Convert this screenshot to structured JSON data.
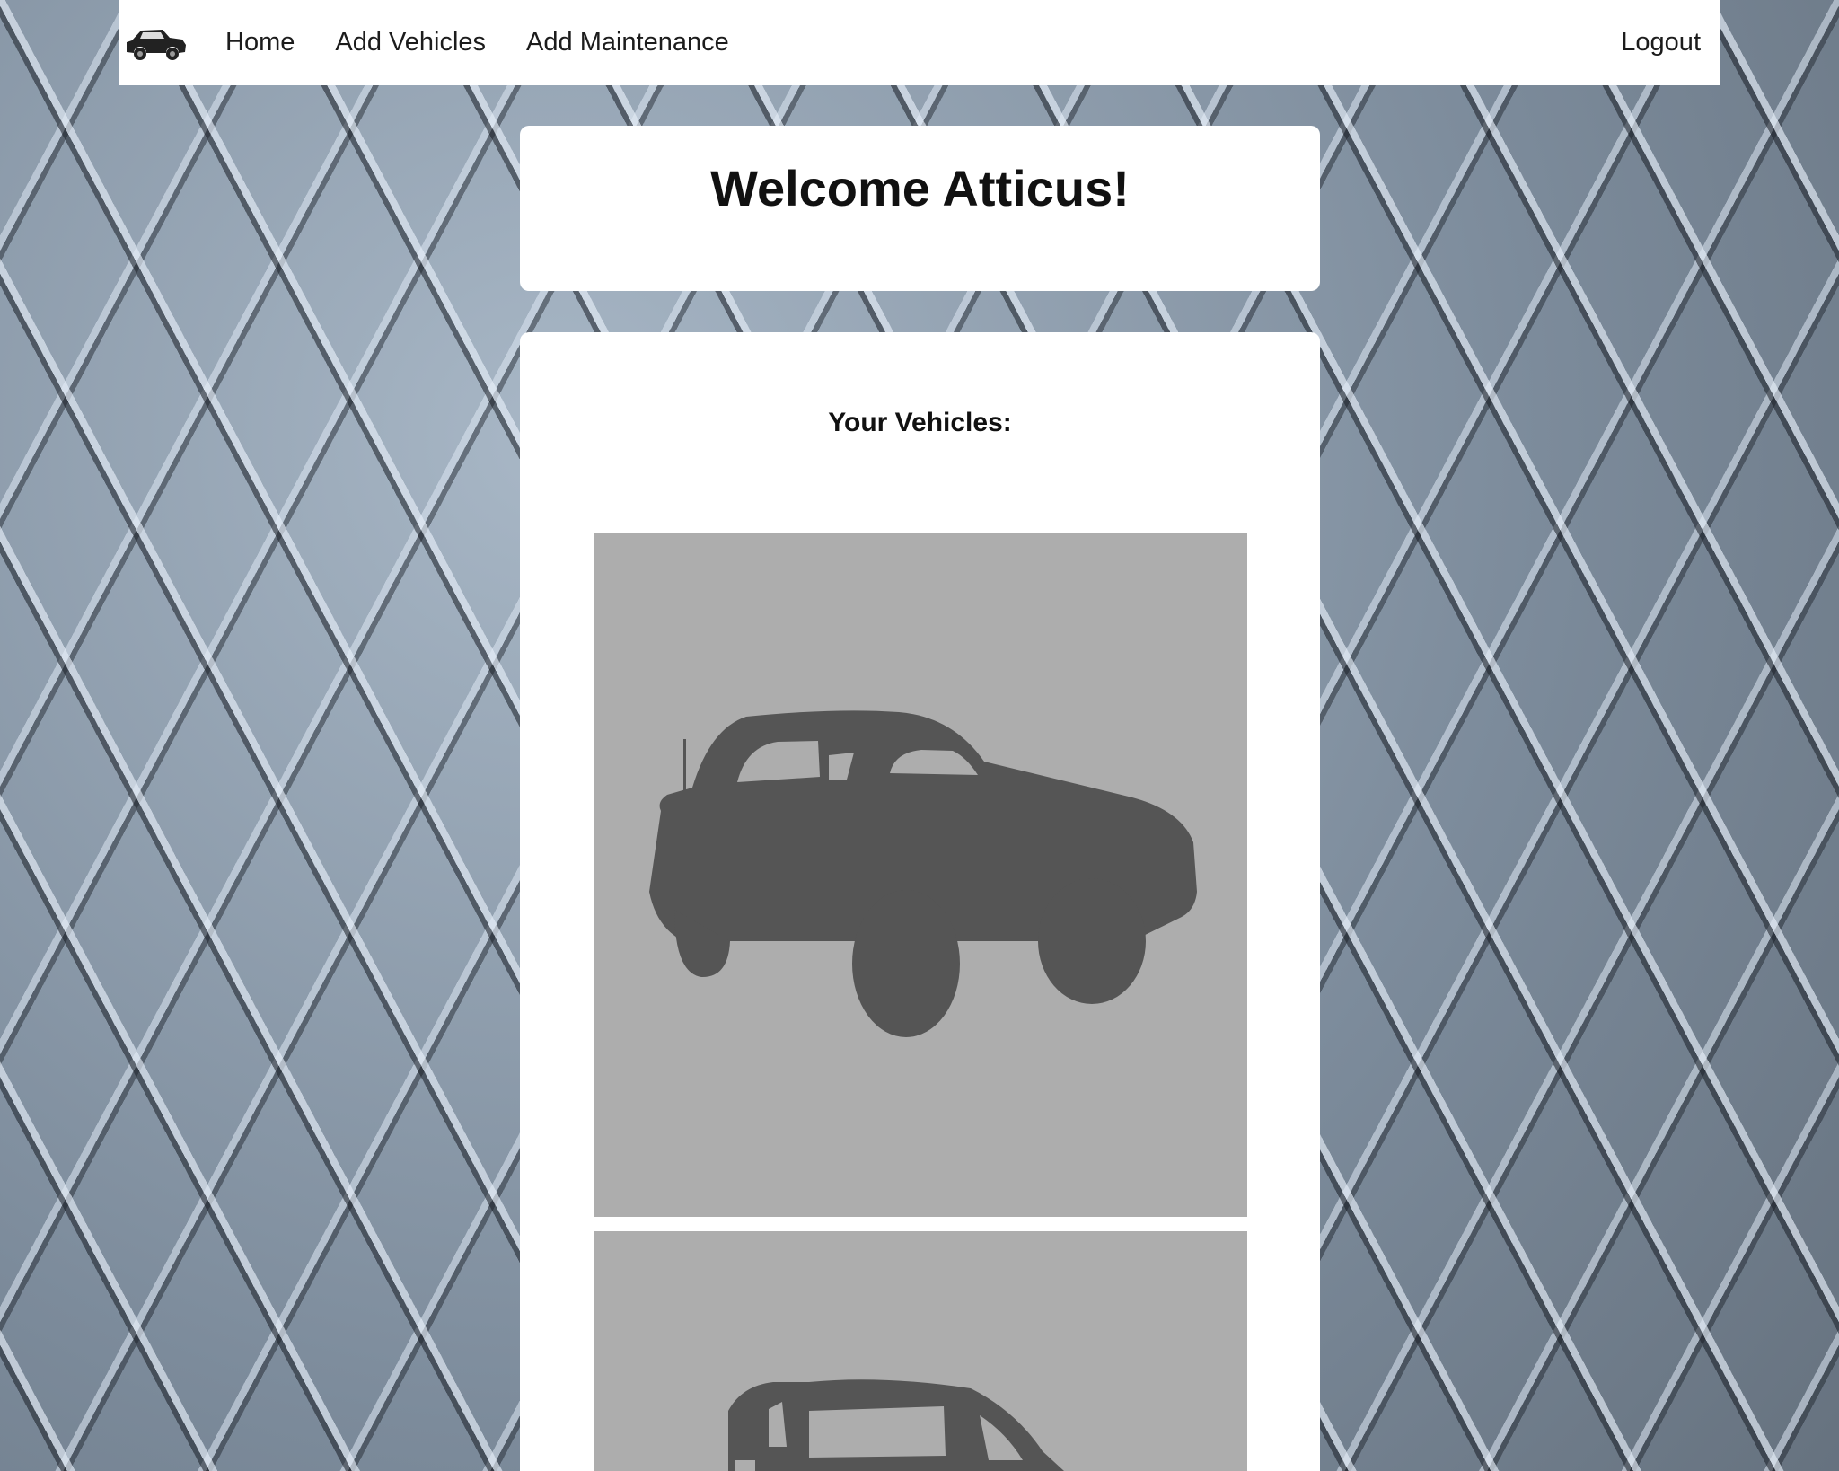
{
  "nav": {
    "brand_icon": "truck-logo-icon",
    "links": [
      {
        "label": "Home"
      },
      {
        "label": "Add Vehicles"
      },
      {
        "label": "Add Maintenance"
      }
    ],
    "logout_label": "Logout"
  },
  "welcome": {
    "title": "Welcome Atticus!"
  },
  "vehicles": {
    "heading": "Your Vehicles:",
    "items": [
      {
        "image_icon": "truck-silhouette-icon"
      },
      {
        "image_icon": "truck-silhouette-icon"
      }
    ]
  },
  "colors": {
    "tile_background": "#adadad",
    "silhouette": "#555555"
  }
}
